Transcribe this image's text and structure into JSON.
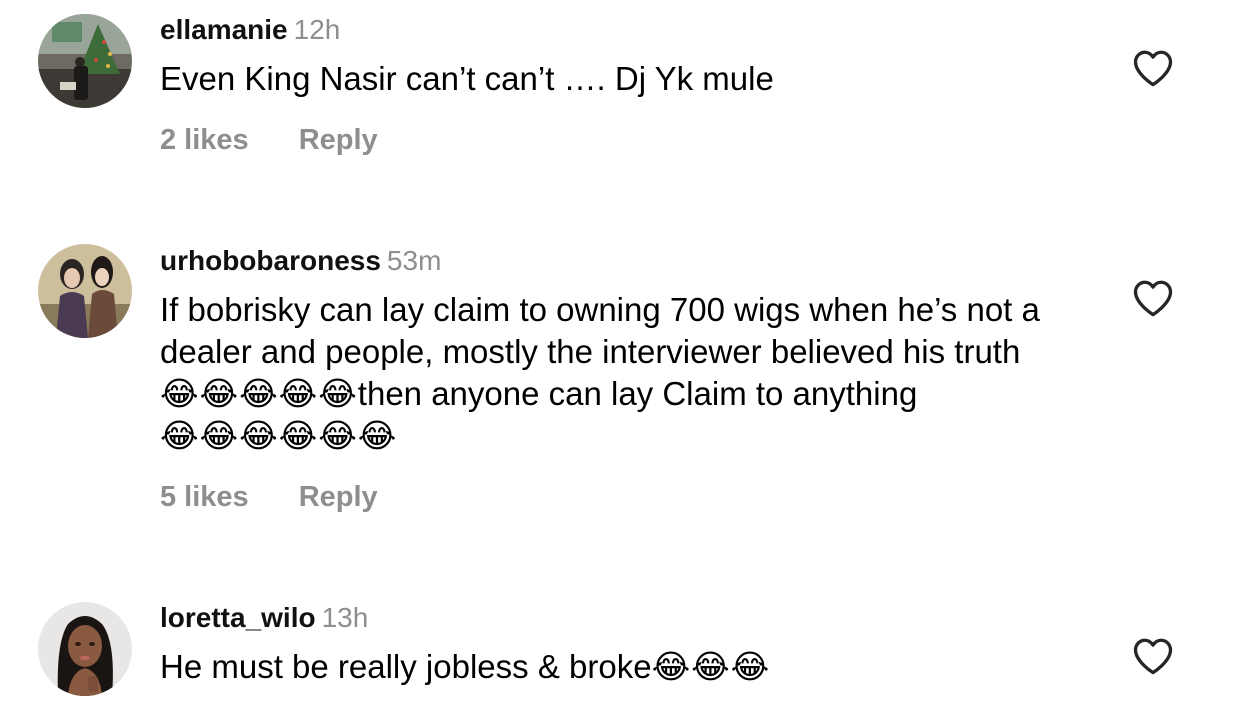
{
  "comments": [
    {
      "username": "ellamanie",
      "timestamp": "12h",
      "text": "Even King Nasir can’t can’t …. Dj Yk mule",
      "emojis": "",
      "likes": "2 likes",
      "reply": "Reply"
    },
    {
      "username": "urhobobaroness",
      "timestamp": "53m",
      "text_part1": "If bobrisky can lay claim to owning 700 wigs when he’s not a dealer and people, mostly the interviewer believed his truth",
      "emojis_1": "😂😂😂😂😂",
      "text_part2": "then anyone can lay Claim to anything ",
      "emojis_2": "😂😂😂😂😂😂",
      "likes": "5 likes",
      "reply": "Reply"
    },
    {
      "username": "loretta_wilo",
      "timestamp": "13h",
      "text": "He must be really jobless & broke",
      "emojis": "😂😂😂",
      "likes": "",
      "reply": ""
    }
  ],
  "icons": {
    "like": "heart-outline-icon"
  },
  "colors": {
    "secondary_text": "#8e8e8e",
    "primary_text": "#000000",
    "background": "#ffffff"
  }
}
